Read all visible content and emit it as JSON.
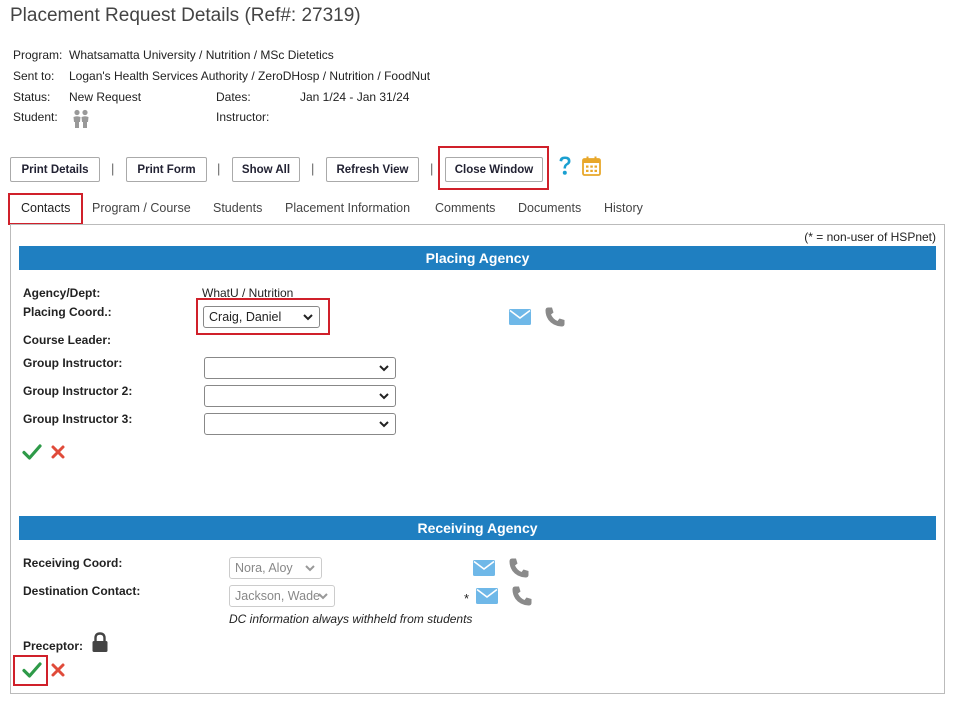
{
  "page": {
    "title": "Placement Request Details (Ref#: 27319)"
  },
  "details": {
    "program_label": "Program:",
    "program_value": "Whatsamatta University / Nutrition / MSc Dietetics",
    "sent_to_label": "Sent to:",
    "sent_to_value": "Logan's Health Services Authority / ZeroDHosp / Nutrition / FoodNut",
    "status_label": "Status:",
    "status_value": "New Request",
    "dates_label": "Dates:",
    "dates_value": "Jan 1/24 - Jan 31/24",
    "student_label": "Student:",
    "instructor_label": "Instructor:"
  },
  "toolbar": {
    "print_details": "Print Details",
    "print_form": "Print Form",
    "show_all": "Show All",
    "refresh_view": "Refresh View",
    "close_window": "Close Window",
    "separator": "|"
  },
  "tabs": [
    {
      "label": "Contacts"
    },
    {
      "label": "Program / Course"
    },
    {
      "label": "Students"
    },
    {
      "label": "Placement Information"
    },
    {
      "label": "Comments"
    },
    {
      "label": "Documents"
    },
    {
      "label": "History"
    }
  ],
  "panel": {
    "legend": "(* = non-user of HSPnet)"
  },
  "placing": {
    "header": "Placing Agency",
    "agency_label": "Agency/Dept:",
    "agency_value": "WhatU / Nutrition",
    "coord_label": "Placing Coord.:",
    "coord_value": "Craig, Daniel",
    "course_leader_label": "Course Leader:",
    "group_instructor_label": "Group Instructor:",
    "group_instructor_value": "",
    "group_instructor2_label": "Group Instructor 2:",
    "group_instructor2_value": "",
    "group_instructor3_label": "Group Instructor 3:",
    "group_instructor3_value": ""
  },
  "receiving": {
    "header": "Receiving Agency",
    "coord_label": "Receiving Coord:",
    "coord_value": "Nora, Aloy",
    "dest_label": "Destination Contact:",
    "dest_value": "Jackson, Wade",
    "dest_marker": "*",
    "dc_note": "DC information always withheld from students",
    "preceptor_label": "Preceptor:"
  },
  "colors": {
    "accent_bar": "#1f7fc1",
    "highlight": "#d0202a",
    "confirm": "#2e9a48",
    "cancel": "#e04b3a",
    "email_icon": "#6fb8e8",
    "phone_icon": "#8a8a8a",
    "help_icon": "#1a9fd0",
    "calendar_icon": "#e8a72a"
  }
}
